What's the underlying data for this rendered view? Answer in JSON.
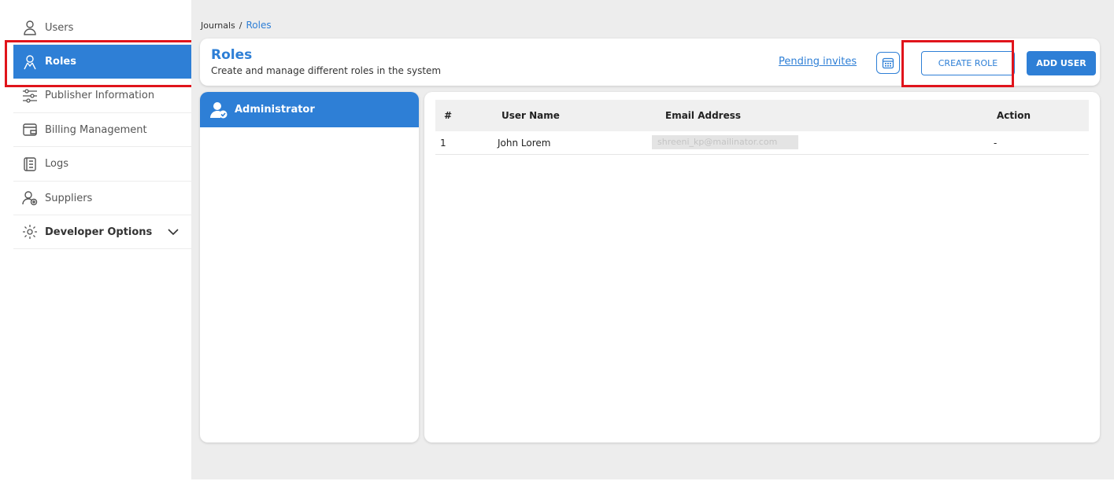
{
  "sidebar": {
    "items": [
      {
        "label": "Users",
        "icon": "user-icon"
      },
      {
        "label": "Roles",
        "icon": "roles-icon"
      },
      {
        "label": "Publisher Information",
        "icon": "sliders-icon"
      },
      {
        "label": "Billing Management",
        "icon": "wallet-icon"
      },
      {
        "label": "Logs",
        "icon": "notebook-icon"
      },
      {
        "label": "Suppliers",
        "icon": "supplier-icon"
      },
      {
        "label": "Developer Options",
        "icon": "gear-icon"
      }
    ]
  },
  "breadcrumb": {
    "parent": "Journals",
    "separator": "/",
    "current": "Roles"
  },
  "header": {
    "title": "Roles",
    "subtitle": "Create and manage different roles in the system",
    "pending_link": "Pending invites",
    "create_role_label": "CREATE ROLE",
    "add_user_label": "ADD USER"
  },
  "roles": [
    {
      "label": "Administrator"
    }
  ],
  "table": {
    "columns": [
      "#",
      "User Name",
      "Email Address",
      "Action"
    ],
    "rows": [
      {
        "index": "1",
        "name": "John Lorem",
        "email": "shreeni_kp@mailinator.com",
        "action": "-"
      }
    ]
  },
  "colors": {
    "accent": "#2e7fd6",
    "highlight": "#e0141b"
  }
}
